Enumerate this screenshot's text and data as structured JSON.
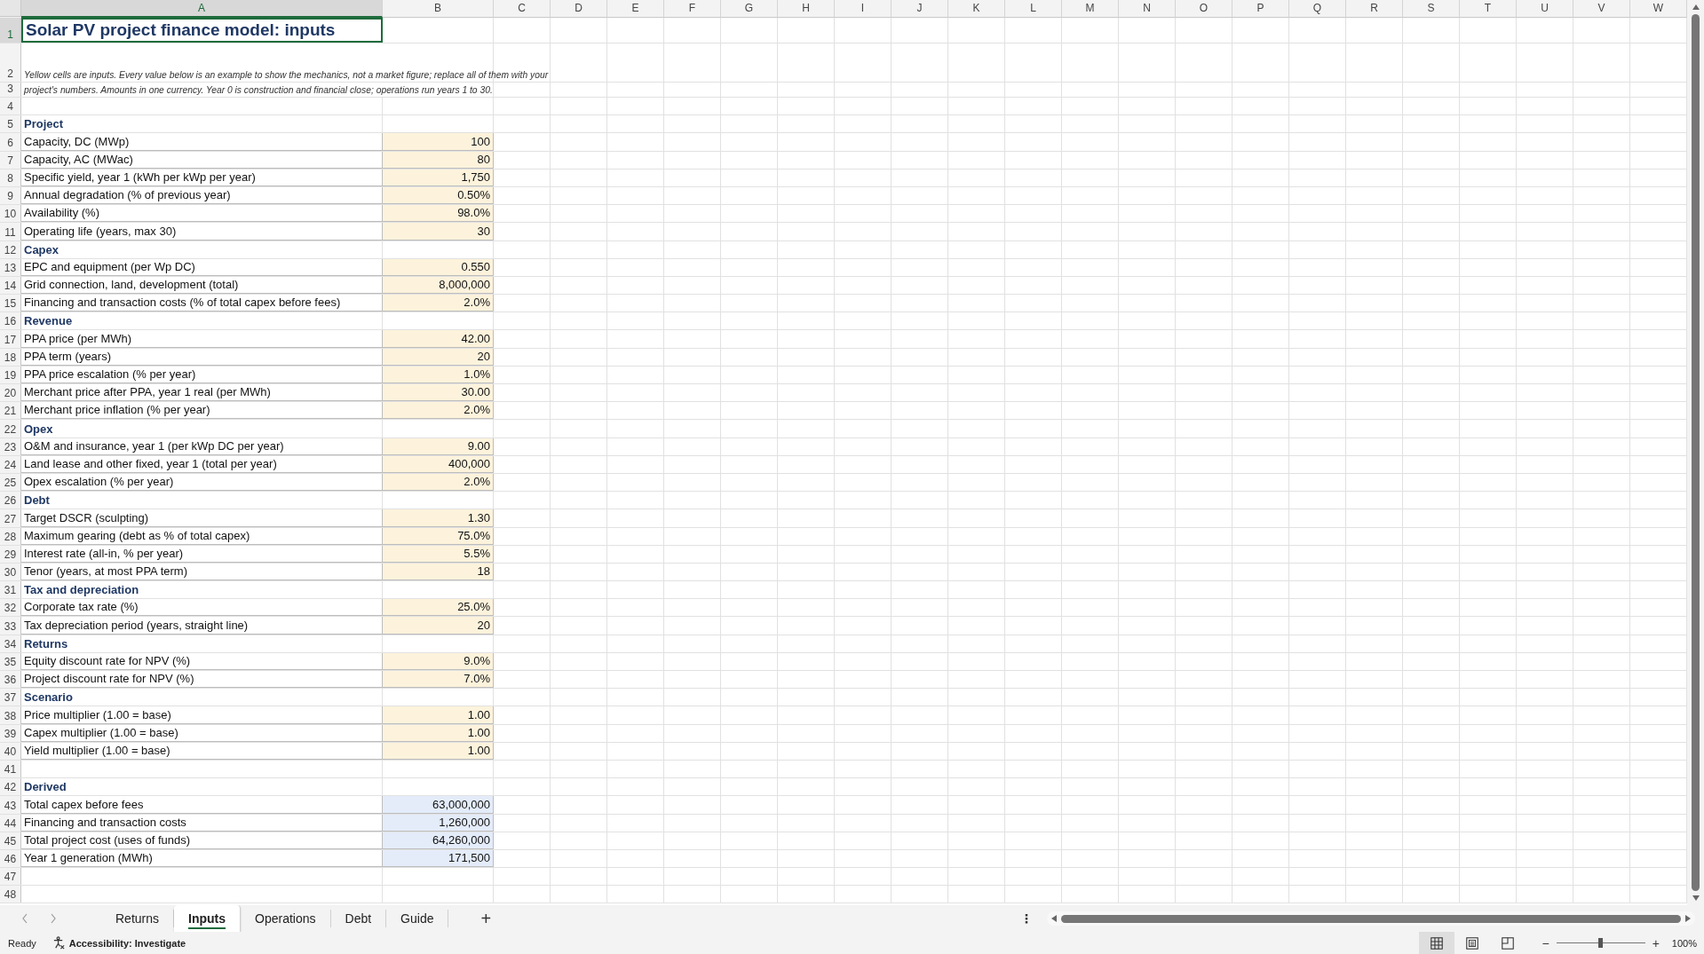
{
  "columns": [
    {
      "label": "A",
      "selected": true
    },
    {
      "label": "B",
      "selected": false
    },
    {
      "label": "C",
      "selected": false
    },
    {
      "label": "D",
      "selected": false
    },
    {
      "label": "E",
      "selected": false
    },
    {
      "label": "F",
      "selected": false
    },
    {
      "label": "G",
      "selected": false
    },
    {
      "label": "H",
      "selected": false
    },
    {
      "label": "I",
      "selected": false
    },
    {
      "label": "J",
      "selected": false
    },
    {
      "label": "K",
      "selected": false
    },
    {
      "label": "L",
      "selected": false
    },
    {
      "label": "M",
      "selected": false
    },
    {
      "label": "N",
      "selected": false
    },
    {
      "label": "O",
      "selected": false
    },
    {
      "label": "P",
      "selected": false
    },
    {
      "label": "Q",
      "selected": false
    },
    {
      "label": "R",
      "selected": false
    },
    {
      "label": "S",
      "selected": false
    },
    {
      "label": "T",
      "selected": false
    },
    {
      "label": "U",
      "selected": false
    },
    {
      "label": "V",
      "selected": false
    },
    {
      "label": "W",
      "selected": false
    }
  ],
  "rows": [
    {
      "number": "1",
      "kind": "title",
      "selected": true,
      "label": "Solar PV project finance model: inputs"
    },
    {
      "number": "2",
      "kind": "note",
      "selected": false,
      "label": "Yellow cells are inputs. Every value below is an example to show the mechanics, not a market figure; replace all of them with your"
    },
    {
      "number": "3",
      "kind": "note2",
      "selected": false,
      "label": "project's numbers. Amounts in one currency. Year 0 is construction and financial close; operations run years 1 to 30."
    },
    {
      "number": "4",
      "kind": "blank",
      "selected": false
    },
    {
      "number": "5",
      "kind": "section",
      "selected": false,
      "label": "Project"
    },
    {
      "number": "6",
      "kind": "input",
      "selected": false,
      "label": "Capacity, DC (MWp)",
      "value": "100"
    },
    {
      "number": "7",
      "kind": "input",
      "selected": false,
      "label": "Capacity, AC (MWac)",
      "value": "80"
    },
    {
      "number": "8",
      "kind": "input",
      "selected": false,
      "label": "Specific yield, year 1 (kWh per kWp per year)",
      "value": "1,750"
    },
    {
      "number": "9",
      "kind": "input",
      "selected": false,
      "label": "Annual degradation (% of previous year)",
      "value": "0.50%"
    },
    {
      "number": "10",
      "kind": "input",
      "selected": false,
      "label": "Availability (%)",
      "value": "98.0%"
    },
    {
      "number": "11",
      "kind": "input",
      "selected": false,
      "label": "Operating life (years, max 30)",
      "value": "30"
    },
    {
      "number": "12",
      "kind": "section",
      "selected": false,
      "label": "Capex"
    },
    {
      "number": "13",
      "kind": "input",
      "selected": false,
      "label": "EPC and equipment (per Wp DC)",
      "value": "0.550"
    },
    {
      "number": "14",
      "kind": "input",
      "selected": false,
      "label": "Grid connection, land, development (total)",
      "value": "8,000,000"
    },
    {
      "number": "15",
      "kind": "input",
      "selected": false,
      "label": "Financing and transaction costs (% of total capex before fees)",
      "value": "2.0%"
    },
    {
      "number": "16",
      "kind": "section",
      "selected": false,
      "label": "Revenue"
    },
    {
      "number": "17",
      "kind": "input",
      "selected": false,
      "label": "PPA price (per MWh)",
      "value": "42.00"
    },
    {
      "number": "18",
      "kind": "input",
      "selected": false,
      "label": "PPA term (years)",
      "value": "20"
    },
    {
      "number": "19",
      "kind": "input",
      "selected": false,
      "label": "PPA price escalation (% per year)",
      "value": "1.0%"
    },
    {
      "number": "20",
      "kind": "input",
      "selected": false,
      "label": "Merchant price after PPA, year 1 real (per MWh)",
      "value": "30.00"
    },
    {
      "number": "21",
      "kind": "input",
      "selected": false,
      "label": "Merchant price inflation (% per year)",
      "value": "2.0%"
    },
    {
      "number": "22",
      "kind": "section",
      "selected": false,
      "label": "Opex"
    },
    {
      "number": "23",
      "kind": "input",
      "selected": false,
      "label": "O&M and insurance, year 1 (per kWp DC per year)",
      "value": "9.00"
    },
    {
      "number": "24",
      "kind": "input",
      "selected": false,
      "label": "Land lease and other fixed, year 1 (total per year)",
      "value": "400,000"
    },
    {
      "number": "25",
      "kind": "input",
      "selected": false,
      "label": "Opex escalation (% per year)",
      "value": "2.0%"
    },
    {
      "number": "26",
      "kind": "section",
      "selected": false,
      "label": "Debt"
    },
    {
      "number": "27",
      "kind": "input",
      "selected": false,
      "label": "Target DSCR (sculpting)",
      "value": "1.30"
    },
    {
      "number": "28",
      "kind": "input",
      "selected": false,
      "label": "Maximum gearing (debt as % of total capex)",
      "value": "75.0%"
    },
    {
      "number": "29",
      "kind": "input",
      "selected": false,
      "label": "Interest rate (all-in, % per year)",
      "value": "5.5%"
    },
    {
      "number": "30",
      "kind": "input",
      "selected": false,
      "label": "Tenor (years, at most PPA term)",
      "value": "18"
    },
    {
      "number": "31",
      "kind": "section",
      "selected": false,
      "label": "Tax and depreciation"
    },
    {
      "number": "32",
      "kind": "input",
      "selected": false,
      "label": "Corporate tax rate (%)",
      "value": "25.0%"
    },
    {
      "number": "33",
      "kind": "input",
      "selected": false,
      "label": "Tax depreciation period (years, straight line)",
      "value": "20"
    },
    {
      "number": "34",
      "kind": "section",
      "selected": false,
      "label": "Returns"
    },
    {
      "number": "35",
      "kind": "input",
      "selected": false,
      "label": "Equity discount rate for NPV (%)",
      "value": "9.0%"
    },
    {
      "number": "36",
      "kind": "input",
      "selected": false,
      "label": "Project discount rate for NPV (%)",
      "value": "7.0%"
    },
    {
      "number": "37",
      "kind": "section",
      "selected": false,
      "label": "Scenario"
    },
    {
      "number": "38",
      "kind": "input",
      "selected": false,
      "label": "Price multiplier (1.00 = base)",
      "value": "1.00"
    },
    {
      "number": "39",
      "kind": "input",
      "selected": false,
      "label": "Capex multiplier (1.00 = base)",
      "value": "1.00"
    },
    {
      "number": "40",
      "kind": "input",
      "selected": false,
      "label": "Yield multiplier (1.00 = base)",
      "value": "1.00"
    },
    {
      "number": "41",
      "kind": "blank",
      "selected": false
    },
    {
      "number": "42",
      "kind": "section",
      "selected": false,
      "label": "Derived"
    },
    {
      "number": "43",
      "kind": "derived",
      "selected": false,
      "label": "Total capex before fees",
      "value": "63,000,000"
    },
    {
      "number": "44",
      "kind": "derived",
      "selected": false,
      "label": "Financing and transaction costs",
      "value": "1,260,000"
    },
    {
      "number": "45",
      "kind": "derived",
      "selected": false,
      "label": "Total project cost (uses of funds)",
      "value": "64,260,000"
    },
    {
      "number": "46",
      "kind": "derived",
      "selected": false,
      "label": "Year 1 generation (MWh)",
      "value": "171,500"
    },
    {
      "number": "47",
      "kind": "blank",
      "selected": false
    },
    {
      "number": "48",
      "kind": "blank",
      "selected": false
    }
  ],
  "sheet_tabs": [
    {
      "label": "Returns",
      "selected": false
    },
    {
      "label": "Inputs",
      "selected": true
    },
    {
      "label": "Operations",
      "selected": false
    },
    {
      "label": "Debt",
      "selected": false
    },
    {
      "label": "Guide",
      "selected": false
    }
  ],
  "add_sheet": "+",
  "tab_menu": "⋮",
  "status_bar": {
    "status": "Ready",
    "accessibility": "Accessibility: Investigate",
    "views": [
      {
        "kind": "normal",
        "selected": true
      },
      {
        "kind": "page-layout",
        "selected": false
      },
      {
        "kind": "page-break",
        "selected": false
      }
    ],
    "zoom_out": "−",
    "zoom_in": "+",
    "zoom_level": {
      "level": 0.5
    },
    "zoom": "100%"
  }
}
